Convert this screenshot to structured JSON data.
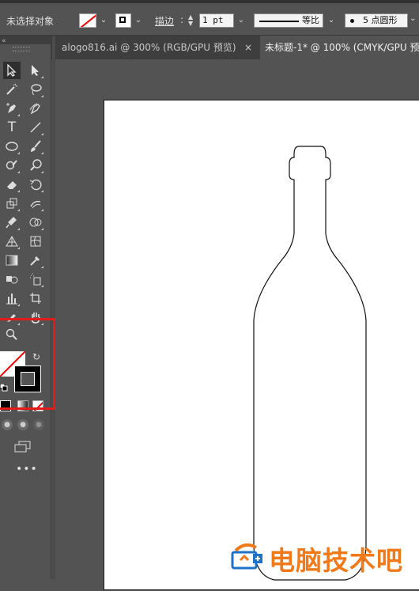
{
  "control_bar": {
    "selection_label": "未选择对象",
    "stroke_label": "描边",
    "stroke_weight": "1 pt",
    "profile_label": "等比",
    "brush_label": "5 点圆形"
  },
  "tabs": [
    {
      "label": "alogo816.ai @ 300% (RGB/GPU 预览)",
      "close": "×"
    },
    {
      "label": "未标题-1* @ 100% (CMYK/GPU 预"
    }
  ],
  "tools": {
    "type_glyph": "T",
    "more_glyph": "•••"
  },
  "watermark": {
    "text": "电脑技术吧"
  },
  "colors": {
    "accent_red": "#e41b1b",
    "watermark_orange": "#f07a1a",
    "watermark_blue": "#1e72c8",
    "ui_background": "#535353"
  },
  "icons": [
    "selection-icon",
    "direct-selection-icon",
    "magic-wand-icon",
    "lasso-icon",
    "pen-icon",
    "curvature-icon",
    "type-icon",
    "line-icon",
    "ellipse-icon",
    "paintbrush-icon",
    "shaper-icon",
    "blob-brush-icon",
    "eraser-icon",
    "rotate-icon",
    "scale-icon",
    "warp-icon",
    "puppet-warp-icon",
    "shape-builder-icon",
    "perspective-grid-icon",
    "mesh-icon",
    "gradient-icon",
    "eyedropper-icon",
    "blend-icon",
    "symbol-sprayer-icon",
    "column-graph-icon",
    "artboard-icon",
    "slice-icon",
    "hand-icon",
    "zoom-icon"
  ]
}
